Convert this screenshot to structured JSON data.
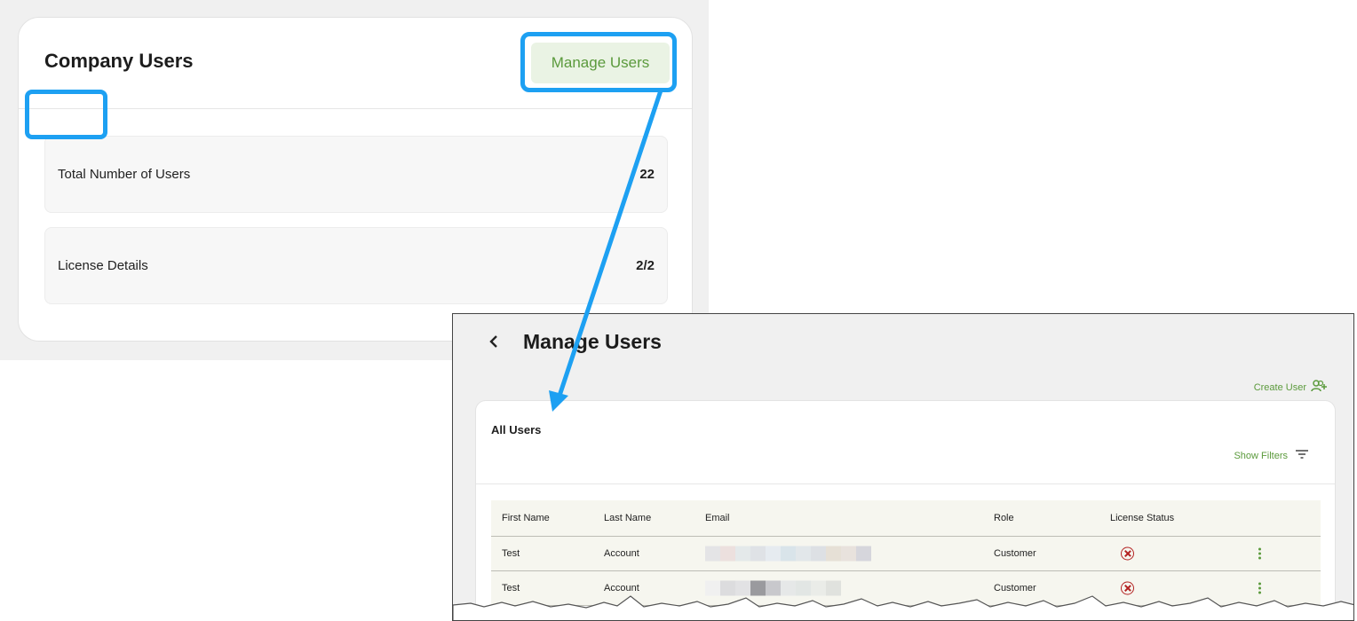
{
  "company_card": {
    "title": "Company Users",
    "manage_button": "Manage Users",
    "stats": [
      {
        "label": "Total Number of Users",
        "value": "22"
      },
      {
        "label": "License Details",
        "value": "2/2"
      }
    ]
  },
  "manage_screen": {
    "title": "Manage Users",
    "create_user": "Create User",
    "section_title": "All Users",
    "show_filters": "Show Filters",
    "columns": [
      "First Name",
      "Last Name",
      "Email",
      "Role",
      "License Status"
    ],
    "rows": [
      {
        "first": "Test",
        "last": "Account",
        "email": "",
        "role": "Customer",
        "license_status": "unlicensed"
      },
      {
        "first": "Test",
        "last": "Account",
        "email": "",
        "role": "Customer",
        "license_status": "unlicensed"
      }
    ]
  },
  "colors": {
    "accent_green": "#5b9a3c",
    "highlight_blue": "#1da0f2",
    "status_red": "#b32121"
  },
  "icons": [
    "chevron-left-icon",
    "add-user-icon",
    "filter-lines-icon",
    "cancel-circle-icon",
    "kebab-menu-icon",
    "arrow-connector"
  ]
}
